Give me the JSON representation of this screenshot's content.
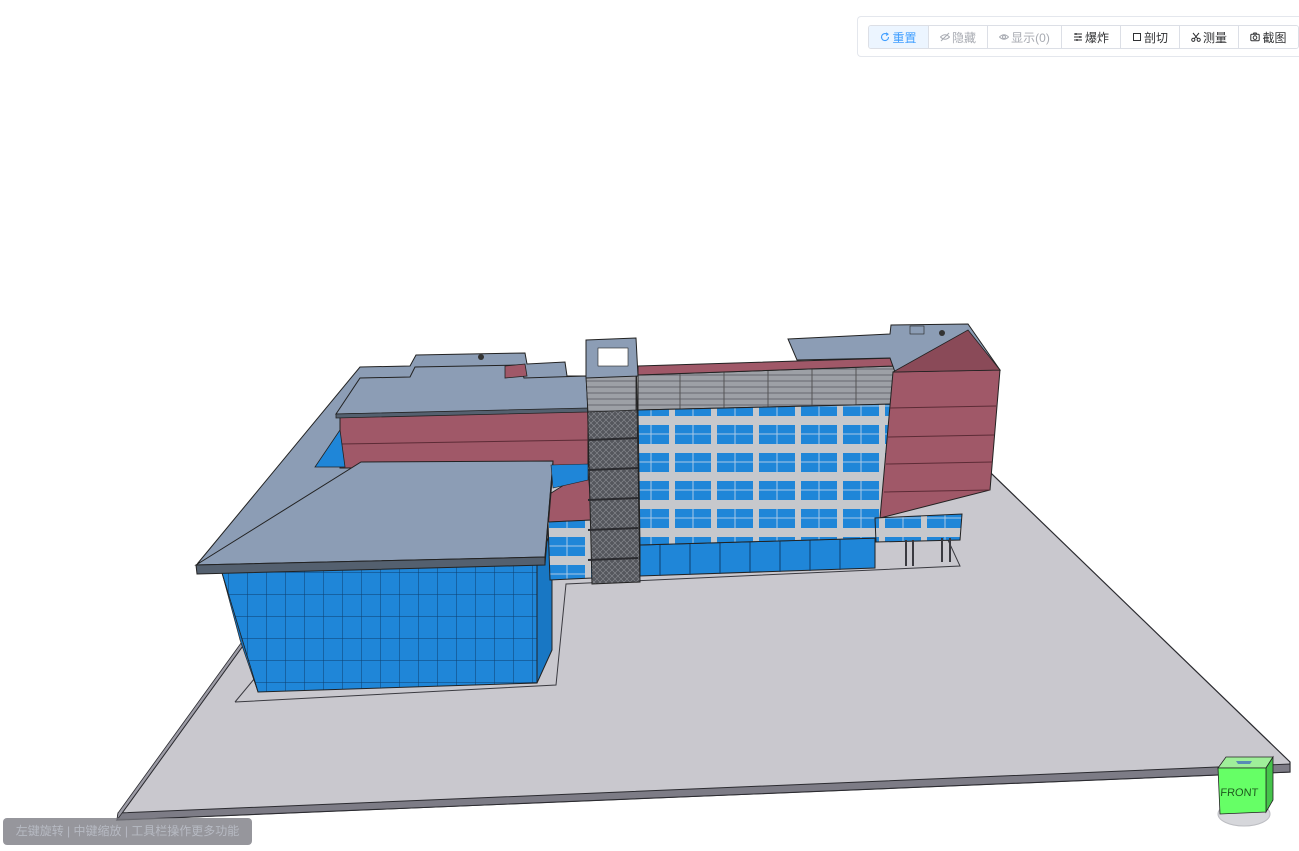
{
  "toolbar": {
    "buttons": [
      {
        "label": "重置",
        "icon": "refresh-icon",
        "state": "active"
      },
      {
        "label": "隐藏",
        "icon": "eye-off-icon",
        "state": "disabled"
      },
      {
        "label": "显示(0)",
        "icon": "eye-icon",
        "state": "disabled"
      },
      {
        "label": "爆炸",
        "icon": "explode-icon",
        "state": "normal"
      },
      {
        "label": "剖切",
        "icon": "section-box-icon",
        "state": "normal"
      },
      {
        "label": "测量",
        "icon": "measure-icon",
        "state": "normal"
      },
      {
        "label": "截图",
        "icon": "camera-icon",
        "state": "normal"
      }
    ],
    "active_color": "#409eff"
  },
  "hint": {
    "text": "左键旋转 | 中键缩放 | 工具栏操作更多功能"
  },
  "navcube": {
    "face_label": "FRONT",
    "color": "#66ff66"
  },
  "model_colors": {
    "roof": "#8c9db5",
    "wall": "#a05868",
    "glass": "#1f86d8",
    "ground": "#c9c8ce",
    "frame": "#6b6b70"
  }
}
